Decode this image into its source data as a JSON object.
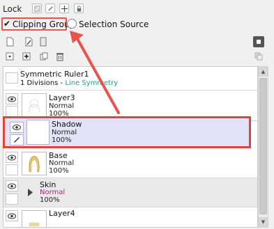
{
  "lock": {
    "label": "Lock"
  },
  "options": {
    "clipping_group": "Clipping Group",
    "selection_source": "Selection Source"
  },
  "layers": [
    {
      "name": "Symmetric Ruler1",
      "info": "1 Divisions - Line Symmetry"
    },
    {
      "name": "Layer3",
      "mode": "Normal",
      "opacity": "100%"
    },
    {
      "name": "Shadow",
      "mode": "Normal",
      "opacity": "100%"
    },
    {
      "name": "Base",
      "mode": "Normal",
      "opacity": "100%"
    },
    {
      "name": "Skin",
      "mode": "Normal",
      "opacity": "100%"
    },
    {
      "name": "Layer4"
    }
  ],
  "colors": {
    "highlight": "#e8544c",
    "selected_row": "#e3e3f7",
    "ruler_info": "#2a9a8a",
    "skin_mode": "#a0268a"
  },
  "icons": [
    "lock-transparency-icon",
    "lock-paint-icon",
    "lock-move-icon",
    "lock-all-icon",
    "new-layer-icon",
    "new-vector-icon",
    "new-folder-icon",
    "merge-icon",
    "add-icon",
    "copy-icon",
    "delete-icon",
    "eye-icon",
    "pencil-icon"
  ]
}
